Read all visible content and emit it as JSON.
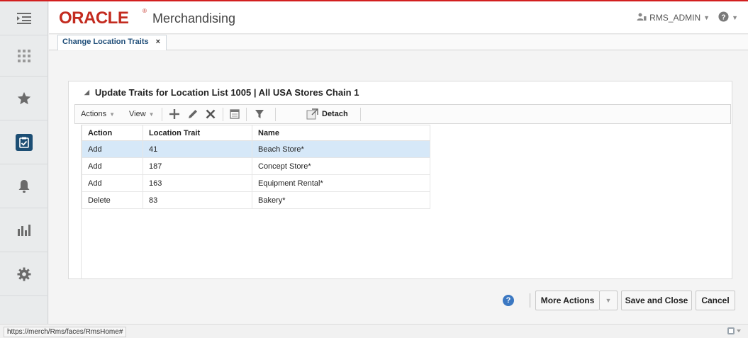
{
  "brand": {
    "logo": "ORACLE",
    "reg_mark": "®",
    "app_name": "Merchandising"
  },
  "user": {
    "name": "RMS_ADMIN"
  },
  "tabs": [
    {
      "label": "Change Location Traits",
      "close": "×"
    }
  ],
  "panel": {
    "title": "Update Traits for Location List 1005 | All USA Stores Chain 1",
    "collapse_glyph": "◢"
  },
  "toolbar": {
    "actions_label": "Actions",
    "view_label": "View",
    "detach_label": "Detach"
  },
  "table": {
    "headers": [
      "Action",
      "Location Trait",
      "Name"
    ],
    "rows": [
      {
        "action": "Add",
        "trait": "41",
        "name": "Beach Store*",
        "selected": true
      },
      {
        "action": "Add",
        "trait": "187",
        "name": "Concept Store*",
        "selected": false
      },
      {
        "action": "Add",
        "trait": "163",
        "name": "Equipment Rental*",
        "selected": false
      },
      {
        "action": "Delete",
        "trait": "83",
        "name": "Bakery*",
        "selected": false
      }
    ]
  },
  "footer": {
    "help_glyph": "?",
    "more_actions_label": "More Actions",
    "save_close_label": "Save and Close",
    "cancel_label": "Cancel"
  },
  "status": {
    "url": "https://merch/Rms/faces/RmsHome#"
  },
  "colors": {
    "brand_red": "#c32b1f",
    "selection": "#d6e8f8",
    "active_nav": "#1c4e74"
  },
  "icons": {
    "sidebar": [
      "tasks-menu-icon",
      "apps-grid-icon",
      "favorites-star-icon",
      "task-clipboard-icon",
      "notifications-bell-icon",
      "reports-chart-icon",
      "settings-gear-icon"
    ],
    "toolbar": [
      "add-icon",
      "edit-icon",
      "delete-icon",
      "freeze-icon",
      "filter-icon",
      "detach-icon"
    ]
  }
}
